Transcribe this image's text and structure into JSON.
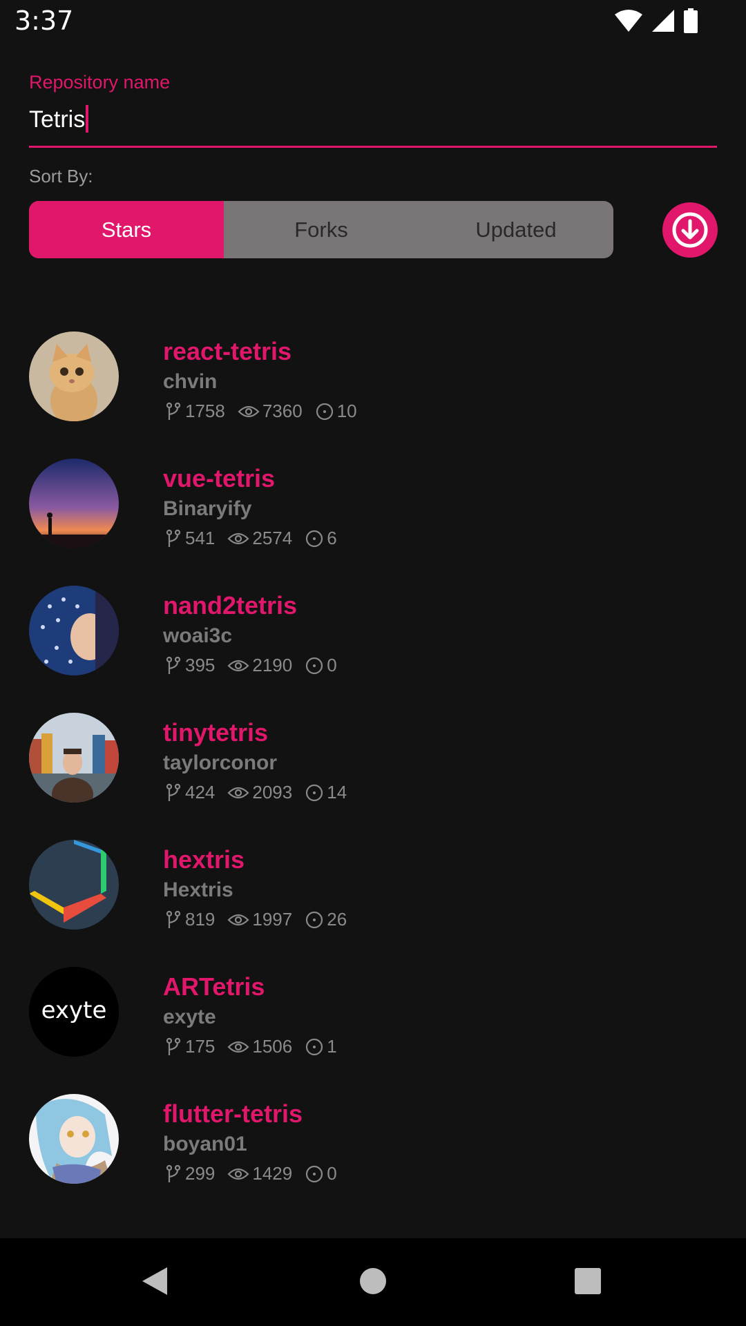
{
  "status": {
    "time": "3:37"
  },
  "search": {
    "label": "Repository name",
    "value": "Tetris"
  },
  "sort": {
    "label": "Sort By:",
    "options": [
      "Stars",
      "Forks",
      "Updated"
    ],
    "selected": "Stars",
    "direction_icon": "arrow-down-circle-icon"
  },
  "colors": {
    "accent": "#e0176a",
    "background": "#121213",
    "segment_bg": "#7a7677",
    "secondary_text": "#7b7b7b"
  },
  "repos": [
    {
      "name": "react-tetris",
      "owner": "chvin",
      "forks": "1758",
      "watchers": "7360",
      "issues": "10",
      "avatar": "cat-photo"
    },
    {
      "name": "vue-tetris",
      "owner": "Binaryify",
      "forks": "541",
      "watchers": "2574",
      "issues": "6",
      "avatar": "sunset-silhouette"
    },
    {
      "name": "nand2tetris",
      "owner": "woai3c",
      "forks": "395",
      "watchers": "2190",
      "issues": "0",
      "avatar": "child-in-hood"
    },
    {
      "name": "tinytetris",
      "owner": "taylorconor",
      "forks": "424",
      "watchers": "2093",
      "issues": "14",
      "avatar": "man-by-canal"
    },
    {
      "name": "hextris",
      "owner": "Hextris",
      "forks": "819",
      "watchers": "1997",
      "issues": "26",
      "avatar": "hexagon-logo"
    },
    {
      "name": "ARTetris",
      "owner": "exyte",
      "forks": "175",
      "watchers": "1506",
      "issues": "1",
      "avatar": "exyte-logo",
      "logo_text": "exyte"
    },
    {
      "name": "flutter-tetris",
      "owner": "boyan01",
      "forks": "299",
      "watchers": "1429",
      "issues": "0",
      "avatar": "anime-character"
    }
  ],
  "nav": {
    "back": "back-icon",
    "home": "home-icon",
    "recents": "recents-icon"
  }
}
